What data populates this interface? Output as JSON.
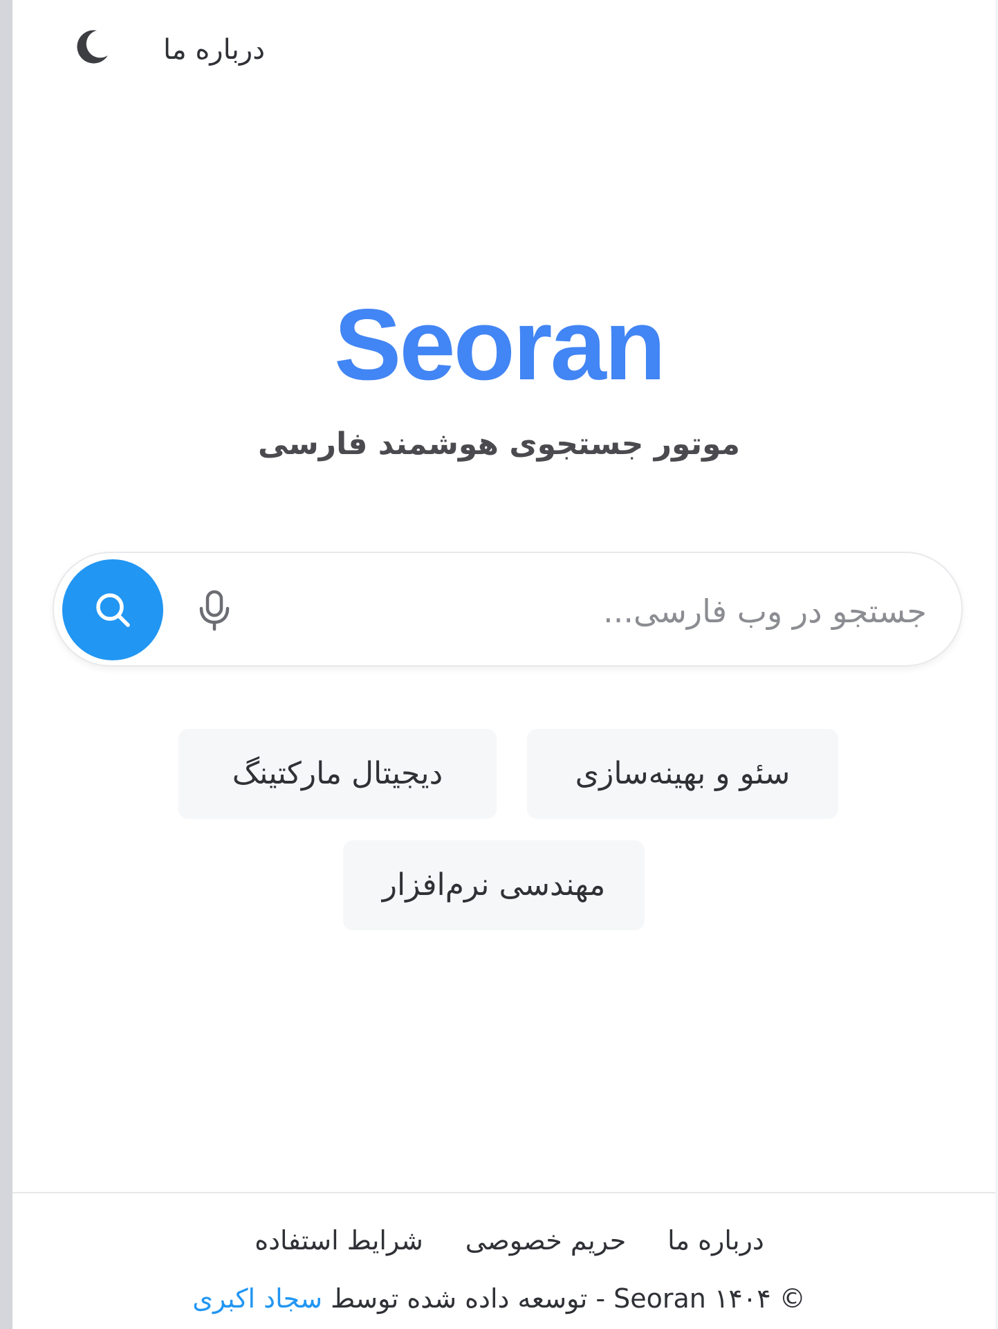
{
  "header": {
    "about_label": "درباره ما",
    "theme_icon": "moon-icon"
  },
  "brand": {
    "name": "Seoran",
    "tagline": "موتور جستجوی هوشمند فارسی",
    "color": "#4285f4"
  },
  "search": {
    "placeholder": "جستجو در وب فارسی...",
    "value": "",
    "button_color": "#2196f3",
    "button_icon": "search-icon",
    "voice_icon": "microphone-icon"
  },
  "suggestions": [
    "سئو و بهینه‌سازی",
    "دیجیتال مارکتینگ",
    "مهندسی نرم‌افزار"
  ],
  "footer": {
    "links": [
      "درباره ما",
      "حریم خصوصی",
      "شرایط استفاده"
    ],
    "copyright_text": "© ۱۴۰۴ Seoran - توسعه داده شده توسط",
    "author": "سجاد اکبری",
    "author_color": "#2196f3"
  }
}
